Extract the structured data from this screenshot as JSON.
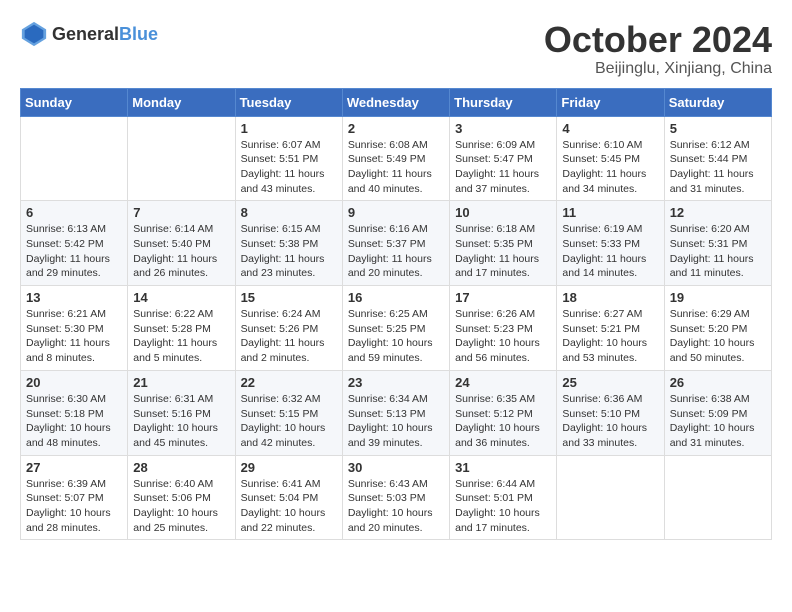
{
  "logo": {
    "general": "General",
    "blue": "Blue"
  },
  "title": "October 2024",
  "location": "Beijinglu, Xinjiang, China",
  "weekdays": [
    "Sunday",
    "Monday",
    "Tuesday",
    "Wednesday",
    "Thursday",
    "Friday",
    "Saturday"
  ],
  "weeks": [
    [
      {
        "day": "",
        "sunrise": "",
        "sunset": "",
        "daylight": ""
      },
      {
        "day": "",
        "sunrise": "",
        "sunset": "",
        "daylight": ""
      },
      {
        "day": "1",
        "sunrise": "Sunrise: 6:07 AM",
        "sunset": "Sunset: 5:51 PM",
        "daylight": "Daylight: 11 hours and 43 minutes."
      },
      {
        "day": "2",
        "sunrise": "Sunrise: 6:08 AM",
        "sunset": "Sunset: 5:49 PM",
        "daylight": "Daylight: 11 hours and 40 minutes."
      },
      {
        "day": "3",
        "sunrise": "Sunrise: 6:09 AM",
        "sunset": "Sunset: 5:47 PM",
        "daylight": "Daylight: 11 hours and 37 minutes."
      },
      {
        "day": "4",
        "sunrise": "Sunrise: 6:10 AM",
        "sunset": "Sunset: 5:45 PM",
        "daylight": "Daylight: 11 hours and 34 minutes."
      },
      {
        "day": "5",
        "sunrise": "Sunrise: 6:12 AM",
        "sunset": "Sunset: 5:44 PM",
        "daylight": "Daylight: 11 hours and 31 minutes."
      }
    ],
    [
      {
        "day": "6",
        "sunrise": "Sunrise: 6:13 AM",
        "sunset": "Sunset: 5:42 PM",
        "daylight": "Daylight: 11 hours and 29 minutes."
      },
      {
        "day": "7",
        "sunrise": "Sunrise: 6:14 AM",
        "sunset": "Sunset: 5:40 PM",
        "daylight": "Daylight: 11 hours and 26 minutes."
      },
      {
        "day": "8",
        "sunrise": "Sunrise: 6:15 AM",
        "sunset": "Sunset: 5:38 PM",
        "daylight": "Daylight: 11 hours and 23 minutes."
      },
      {
        "day": "9",
        "sunrise": "Sunrise: 6:16 AM",
        "sunset": "Sunset: 5:37 PM",
        "daylight": "Daylight: 11 hours and 20 minutes."
      },
      {
        "day": "10",
        "sunrise": "Sunrise: 6:18 AM",
        "sunset": "Sunset: 5:35 PM",
        "daylight": "Daylight: 11 hours and 17 minutes."
      },
      {
        "day": "11",
        "sunrise": "Sunrise: 6:19 AM",
        "sunset": "Sunset: 5:33 PM",
        "daylight": "Daylight: 11 hours and 14 minutes."
      },
      {
        "day": "12",
        "sunrise": "Sunrise: 6:20 AM",
        "sunset": "Sunset: 5:31 PM",
        "daylight": "Daylight: 11 hours and 11 minutes."
      }
    ],
    [
      {
        "day": "13",
        "sunrise": "Sunrise: 6:21 AM",
        "sunset": "Sunset: 5:30 PM",
        "daylight": "Daylight: 11 hours and 8 minutes."
      },
      {
        "day": "14",
        "sunrise": "Sunrise: 6:22 AM",
        "sunset": "Sunset: 5:28 PM",
        "daylight": "Daylight: 11 hours and 5 minutes."
      },
      {
        "day": "15",
        "sunrise": "Sunrise: 6:24 AM",
        "sunset": "Sunset: 5:26 PM",
        "daylight": "Daylight: 11 hours and 2 minutes."
      },
      {
        "day": "16",
        "sunrise": "Sunrise: 6:25 AM",
        "sunset": "Sunset: 5:25 PM",
        "daylight": "Daylight: 10 hours and 59 minutes."
      },
      {
        "day": "17",
        "sunrise": "Sunrise: 6:26 AM",
        "sunset": "Sunset: 5:23 PM",
        "daylight": "Daylight: 10 hours and 56 minutes."
      },
      {
        "day": "18",
        "sunrise": "Sunrise: 6:27 AM",
        "sunset": "Sunset: 5:21 PM",
        "daylight": "Daylight: 10 hours and 53 minutes."
      },
      {
        "day": "19",
        "sunrise": "Sunrise: 6:29 AM",
        "sunset": "Sunset: 5:20 PM",
        "daylight": "Daylight: 10 hours and 50 minutes."
      }
    ],
    [
      {
        "day": "20",
        "sunrise": "Sunrise: 6:30 AM",
        "sunset": "Sunset: 5:18 PM",
        "daylight": "Daylight: 10 hours and 48 minutes."
      },
      {
        "day": "21",
        "sunrise": "Sunrise: 6:31 AM",
        "sunset": "Sunset: 5:16 PM",
        "daylight": "Daylight: 10 hours and 45 minutes."
      },
      {
        "day": "22",
        "sunrise": "Sunrise: 6:32 AM",
        "sunset": "Sunset: 5:15 PM",
        "daylight": "Daylight: 10 hours and 42 minutes."
      },
      {
        "day": "23",
        "sunrise": "Sunrise: 6:34 AM",
        "sunset": "Sunset: 5:13 PM",
        "daylight": "Daylight: 10 hours and 39 minutes."
      },
      {
        "day": "24",
        "sunrise": "Sunrise: 6:35 AM",
        "sunset": "Sunset: 5:12 PM",
        "daylight": "Daylight: 10 hours and 36 minutes."
      },
      {
        "day": "25",
        "sunrise": "Sunrise: 6:36 AM",
        "sunset": "Sunset: 5:10 PM",
        "daylight": "Daylight: 10 hours and 33 minutes."
      },
      {
        "day": "26",
        "sunrise": "Sunrise: 6:38 AM",
        "sunset": "Sunset: 5:09 PM",
        "daylight": "Daylight: 10 hours and 31 minutes."
      }
    ],
    [
      {
        "day": "27",
        "sunrise": "Sunrise: 6:39 AM",
        "sunset": "Sunset: 5:07 PM",
        "daylight": "Daylight: 10 hours and 28 minutes."
      },
      {
        "day": "28",
        "sunrise": "Sunrise: 6:40 AM",
        "sunset": "Sunset: 5:06 PM",
        "daylight": "Daylight: 10 hours and 25 minutes."
      },
      {
        "day": "29",
        "sunrise": "Sunrise: 6:41 AM",
        "sunset": "Sunset: 5:04 PM",
        "daylight": "Daylight: 10 hours and 22 minutes."
      },
      {
        "day": "30",
        "sunrise": "Sunrise: 6:43 AM",
        "sunset": "Sunset: 5:03 PM",
        "daylight": "Daylight: 10 hours and 20 minutes."
      },
      {
        "day": "31",
        "sunrise": "Sunrise: 6:44 AM",
        "sunset": "Sunset: 5:01 PM",
        "daylight": "Daylight: 10 hours and 17 minutes."
      },
      {
        "day": "",
        "sunrise": "",
        "sunset": "",
        "daylight": ""
      },
      {
        "day": "",
        "sunrise": "",
        "sunset": "",
        "daylight": ""
      }
    ]
  ]
}
